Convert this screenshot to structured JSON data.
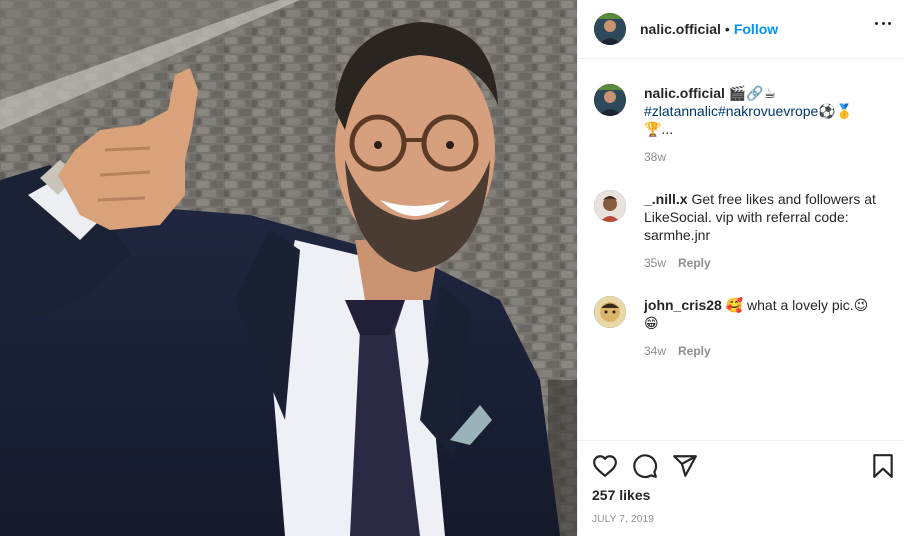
{
  "post": {
    "author": "nalic.official",
    "separator": "•",
    "follow_label": "Follow",
    "more_icon": "more-horizontal-icon"
  },
  "caption": {
    "user": "nalic.official",
    "emojis_line1": "🎬🔗☕",
    "hashtags": "#zlatannalic#nakrovuevrope",
    "emojis_line2": "⚽🥇",
    "emojis_line3": "🏆...",
    "time": "38w"
  },
  "comments": [
    {
      "user": "_.nill.x",
      "text": "Get free likes and followers at LikeSocial. vip with referral code: sarmhe.jnr",
      "time": "35w",
      "reply_label": "Reply"
    },
    {
      "user": "john_cris28",
      "text_before": "🥰 what a lovely pic.😉",
      "text_after": "😁",
      "time": "34w",
      "reply_label": "Reply"
    }
  ],
  "actions": {
    "like_icon": "heart-icon",
    "comment_icon": "comment-icon",
    "share_icon": "share-icon",
    "save_icon": "bookmark-icon"
  },
  "likes_text": "257 likes",
  "date_text": "JULY 7, 2019",
  "colors": {
    "follow": "#0095f6",
    "text": "#262626",
    "muted": "#8e8e8e",
    "hashtag": "#00376b"
  }
}
